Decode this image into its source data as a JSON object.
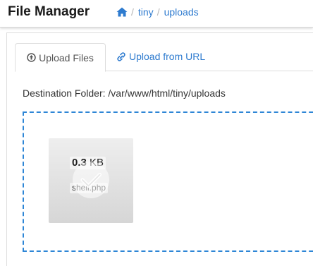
{
  "header": {
    "title": "File Manager",
    "home_icon": "home-icon",
    "breadcrumb": [
      {
        "label": "tiny"
      },
      {
        "label": "uploads"
      }
    ],
    "separator": "/"
  },
  "tabs": [
    {
      "label": "Upload Files",
      "icon": "upload-circle-icon",
      "active": true
    },
    {
      "label": "Upload from URL",
      "icon": "link-icon",
      "active": false
    }
  ],
  "upload": {
    "destination_label": "Destination Folder: /var/www/html/tiny/uploads",
    "file": {
      "size_value": "0.3",
      "size_unit": "KB",
      "name": "shell.php",
      "status_icon": "checkmark-icon"
    }
  },
  "colors": {
    "accent": "#2e7bcf",
    "dropzone_border": "#2e86d6"
  }
}
